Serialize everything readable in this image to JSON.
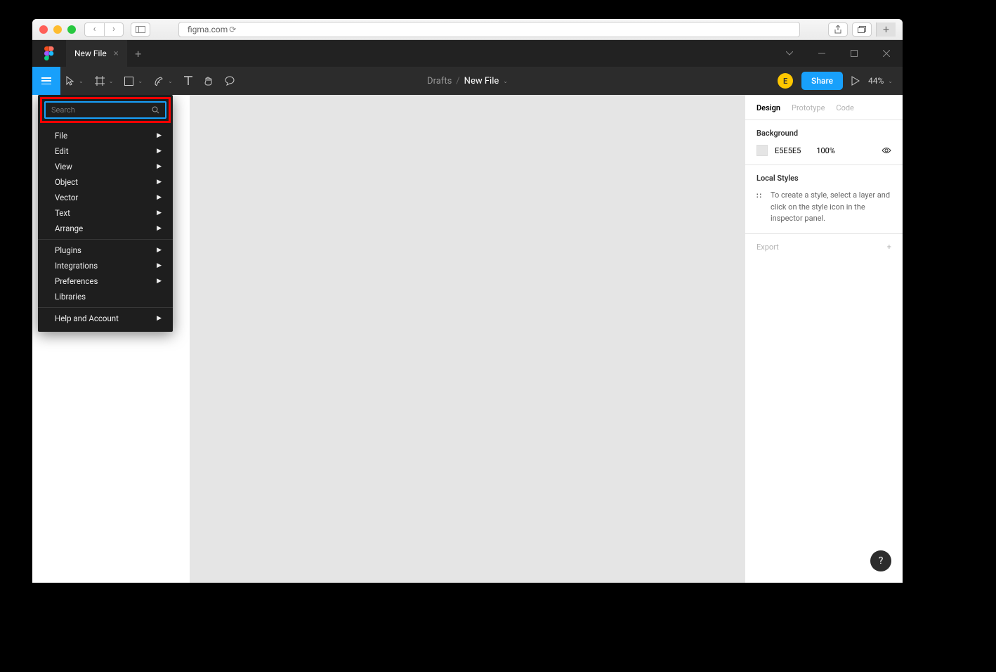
{
  "browser": {
    "url": "figma.com"
  },
  "tabs": {
    "file_name": "New File"
  },
  "breadcrumb": {
    "folder": "Drafts",
    "file": "New File"
  },
  "toolbar": {
    "avatar_initial": "E",
    "share_label": "Share",
    "zoom": "44%"
  },
  "menu": {
    "search_placeholder": "Search",
    "groups": [
      [
        "File",
        "Edit",
        "View",
        "Object",
        "Vector",
        "Text",
        "Arrange"
      ],
      [
        "Plugins",
        "Integrations",
        "Preferences",
        "Libraries"
      ],
      [
        "Help and Account"
      ]
    ],
    "no_submenu": [
      "Libraries"
    ]
  },
  "right_panel": {
    "tabs": [
      "Design",
      "Prototype",
      "Code"
    ],
    "active_tab": "Design",
    "background": {
      "title": "Background",
      "hex": "E5E5E5",
      "opacity": "100%"
    },
    "local_styles": {
      "title": "Local Styles",
      "hint": "To create a style, select a layer and click on the style icon in the inspector panel."
    },
    "export_label": "Export"
  },
  "help_label": "?"
}
